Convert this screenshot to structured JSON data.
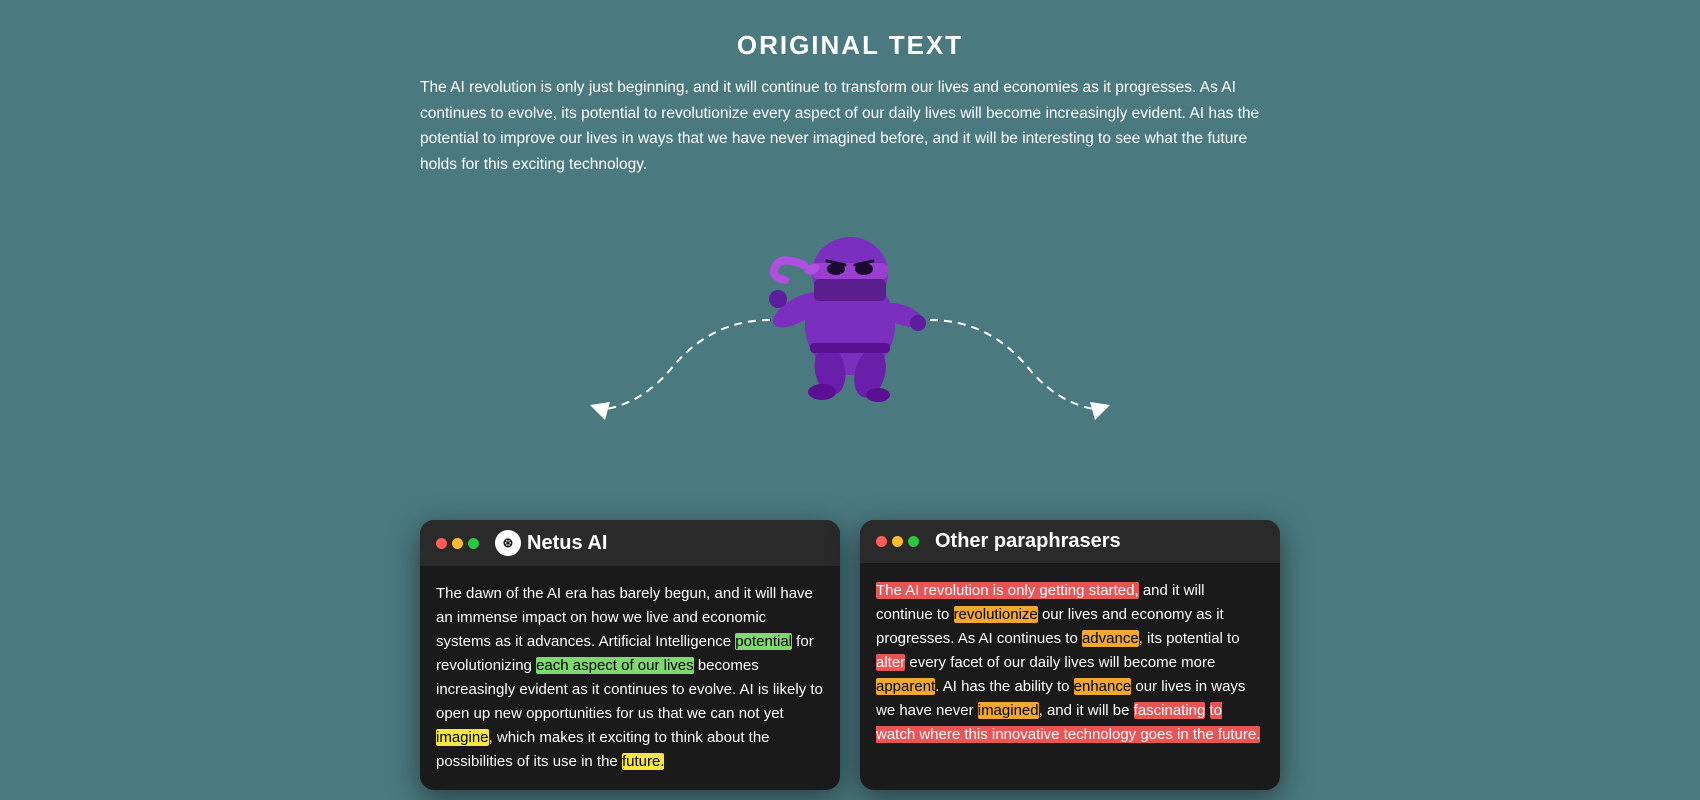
{
  "page": {
    "background_color": "#4a7a80"
  },
  "original_text": {
    "title": "ORIGINAL TEXT",
    "body": "The AI revolution is only just beginning, and it will continue to transform our lives and economies as it progresses. As AI continues to evolve, its potential to revolutionize every aspect of our daily lives will become increasingly evident. AI has the potential to improve our lives in ways that we have never imagined before, and it will be interesting to see what the future holds for this exciting technology."
  },
  "netus_panel": {
    "title": "Netus AI",
    "logo": "N",
    "dots": [
      "#ff5f57",
      "#febc2e",
      "#28c840"
    ],
    "text_segments": [
      {
        "text": "The dawn of the AI era has barely begun, and it will have an immense impact on how we live and economic systems as it advances. Artificial Intelligence ",
        "highlight": "none"
      },
      {
        "text": "potential",
        "highlight": "green"
      },
      {
        "text": " for revolutionizing ",
        "highlight": "none"
      },
      {
        "text": "each aspect of our lives",
        "highlight": "green"
      },
      {
        "text": " becomes increasingly evident as it continues to evolve. AI is likely to open up new opportunities for us that we can not yet ",
        "highlight": "none"
      },
      {
        "text": "imagine",
        "highlight": "yellow"
      },
      {
        "text": ", which makes it exciting to think about the possibilities of its use in the ",
        "highlight": "none"
      },
      {
        "text": "future.",
        "highlight": "yellow"
      }
    ]
  },
  "other_panel": {
    "title": "Other paraphrasers",
    "dots": [
      "#ff5f57",
      "#febc2e",
      "#28c840"
    ],
    "text_segments": [
      {
        "text": "The AI revolution is only getting started,",
        "highlight": "red"
      },
      {
        "text": " and it will continue to ",
        "highlight": "none"
      },
      {
        "text": "revolutionize",
        "highlight": "orange"
      },
      {
        "text": " our lives and economy as it progresses. As AI continues to ",
        "highlight": "none"
      },
      {
        "text": "advance",
        "highlight": "orange"
      },
      {
        "text": ", its potential to ",
        "highlight": "none"
      },
      {
        "text": "alter",
        "highlight": "red"
      },
      {
        "text": " every facet of our daily lives will become more ",
        "highlight": "none"
      },
      {
        "text": "apparent",
        "highlight": "orange"
      },
      {
        "text": ". AI has the ability to ",
        "highlight": "none"
      },
      {
        "text": "enhance",
        "highlight": "orange"
      },
      {
        "text": " our lives in ways we have never ",
        "highlight": "none"
      },
      {
        "text": "imagined",
        "highlight": "orange"
      },
      {
        "text": ", and it will be ",
        "highlight": "none"
      },
      {
        "text": "fascinating",
        "highlight": "red"
      },
      {
        "text": " to watch where this innovative technology goes in the future.",
        "highlight": "red"
      }
    ]
  }
}
